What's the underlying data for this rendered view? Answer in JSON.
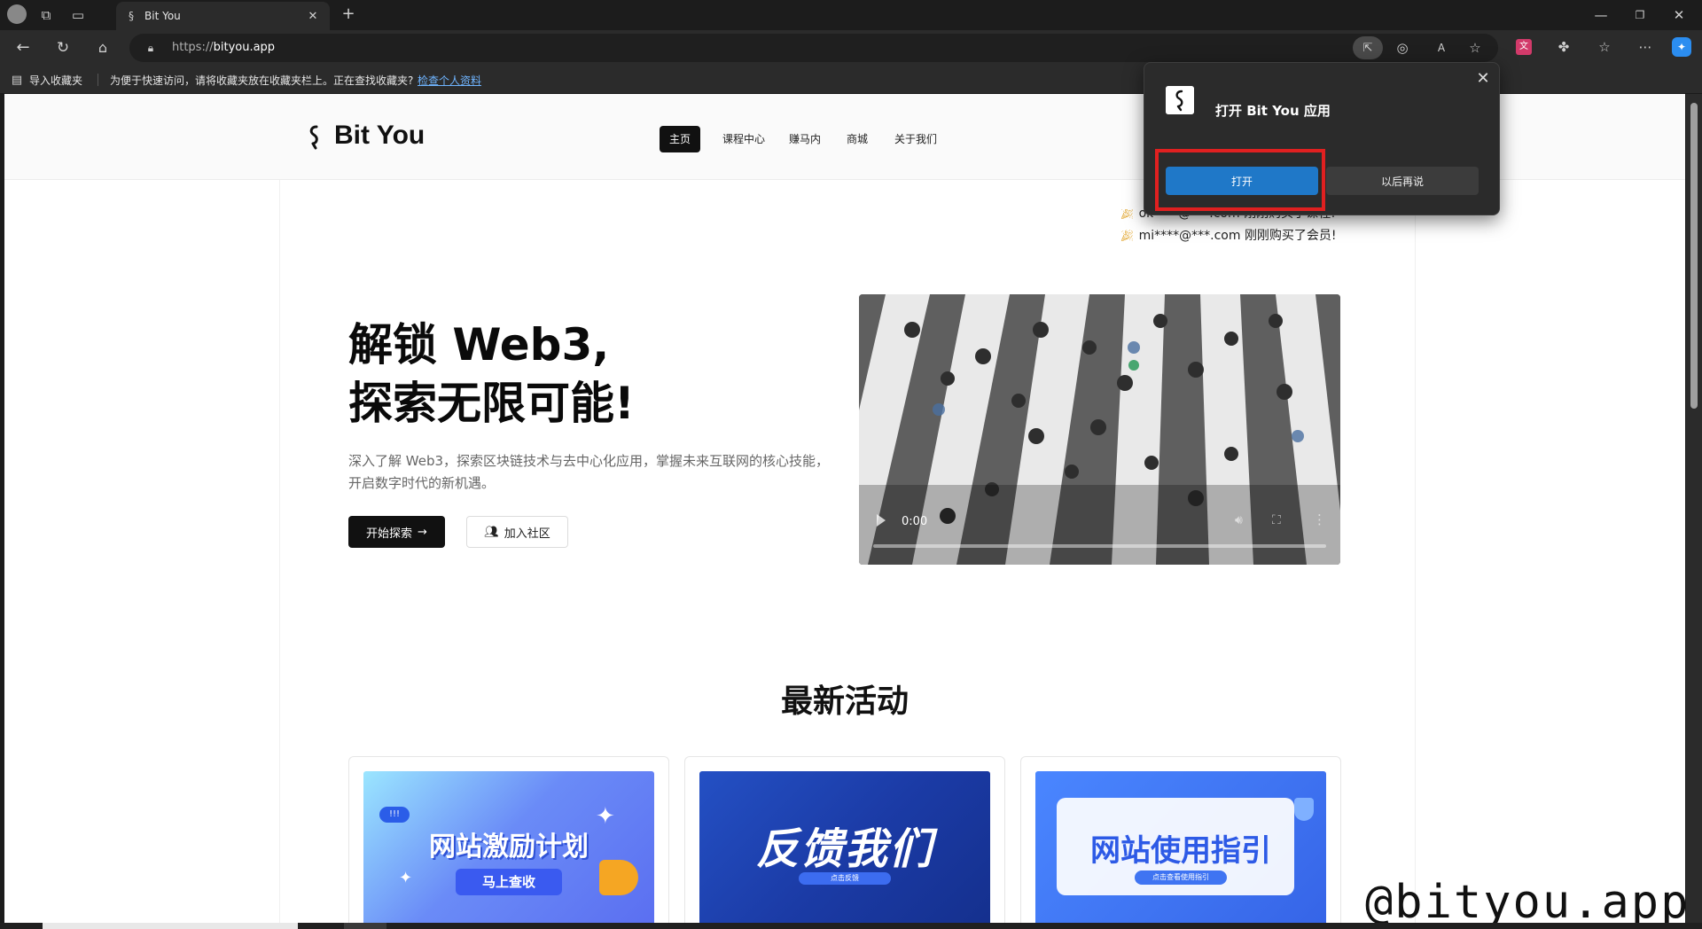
{
  "browser": {
    "tab_title": "Bit You",
    "url_prefix": "https://",
    "url_host": "bityou.app",
    "favorites": {
      "import_label": "导入收藏夹",
      "hint": "为便于快速访问，请将收藏夹放在收藏夹栏上。正在查找收藏夹?",
      "link": "检查个人资料"
    }
  },
  "site": {
    "logo_text": "Bit You",
    "nav": [
      "主页",
      "课程中心",
      "赚马内",
      "商城",
      "关于我们"
    ],
    "ticker": [
      "ok****@***.com 刚刚购买了课程!",
      "mi****@***.com 刚刚购买了会员!"
    ],
    "hero": {
      "title_line1": "解锁 Web3,",
      "title_line2": "探索无限可能!",
      "description": "深入了解 Web3，探索区块链技术与去中心化应用，掌握未来互联网的核心技能，开启数字时代的新机遇。",
      "explore_label": "开始探索",
      "community_label": "加入社区"
    },
    "video": {
      "time": "0:00"
    },
    "section_title": "最新活动",
    "cards": [
      {
        "title": "网站激励计划",
        "subtitle": "马上查收"
      },
      {
        "title": "反馈我们",
        "subtitle": "点击反馈"
      },
      {
        "title": "网站使用指引",
        "subtitle": "点击查看使用指引"
      }
    ]
  },
  "popup": {
    "title": "打开 Bit You 应用",
    "open_label": "打开",
    "later_label": "以后再说"
  },
  "watermark": "@bityou.app",
  "colors": {
    "accent_blue": "#1f78c8",
    "highlight_red": "#e02020",
    "card1": "#5b7cf5",
    "card2": "#1e3ea8",
    "card3": "#3f74f2"
  }
}
